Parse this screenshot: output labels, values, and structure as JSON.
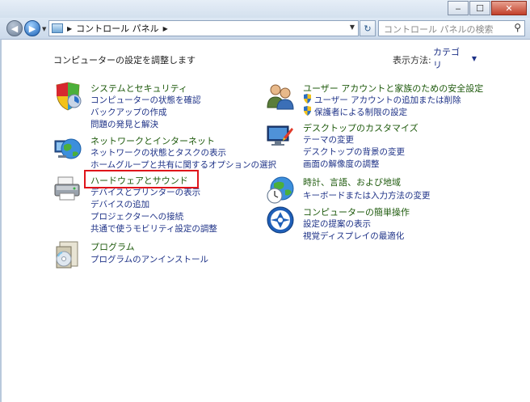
{
  "window": {
    "minimize": "‒",
    "maximize": "☐",
    "close": "✕"
  },
  "address": {
    "crumb": "コントロール パネル"
  },
  "search": {
    "placeholder": "コントロール パネルの検索"
  },
  "heading": "コンピューターの設定を調整します",
  "view": {
    "label": "表示方法:",
    "value": "カテゴリ"
  },
  "categories": {
    "system": {
      "title": "システムとセキュリティ",
      "links": [
        "コンピューターの状態を確認",
        "バックアップの作成",
        "問題の発見と解決"
      ]
    },
    "network": {
      "title": "ネットワークとインターネット",
      "links": [
        "ネットワークの状態とタスクの表示",
        "ホームグループと共有に関するオプションの選択"
      ]
    },
    "hardware": {
      "title": "ハードウェアとサウンド",
      "links": [
        "デバイスとプリンターの表示",
        "デバイスの追加",
        "プロジェクターへの接続",
        "共通で使うモビリティ設定の調整"
      ]
    },
    "programs": {
      "title": "プログラム",
      "links": [
        "プログラムのアンインストール"
      ]
    },
    "users": {
      "title": "ユーザー アカウントと家族のための安全設定",
      "links": [
        "ユーザー アカウントの追加または削除",
        "保護者による制限の設定"
      ]
    },
    "appearance": {
      "title": "デスクトップのカスタマイズ",
      "links": [
        "テーマの変更",
        "デスクトップの背景の変更",
        "画面の解像度の調整"
      ]
    },
    "clock": {
      "title": "時計、言語、および地域",
      "links": [
        "キーボードまたは入力方法の変更"
      ]
    },
    "ease": {
      "title": "コンピューターの簡単操作",
      "links": [
        "設定の提案の表示",
        "視覚ディスプレイの最適化"
      ]
    }
  }
}
